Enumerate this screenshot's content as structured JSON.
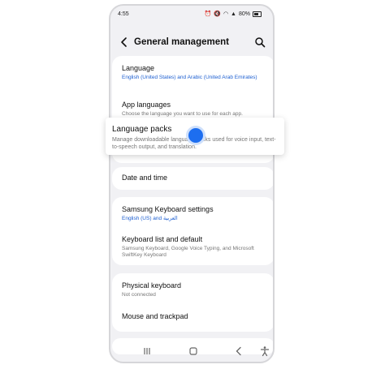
{
  "status": {
    "time": "4:55",
    "battery": "80%"
  },
  "header": {
    "title": "General management"
  },
  "items": {
    "language": {
      "title": "Language",
      "sub": "English (United States) and Arabic (United Arab Emirates)"
    },
    "app_languages": {
      "title": "App languages",
      "sub": "Choose the language you want to use for each app."
    },
    "language_packs": {
      "title": "Language packs",
      "sub": "Manage downloadable language packs used for voice input, text-to-speech output, and translation."
    },
    "date_time": {
      "title": "Date and time"
    },
    "samsung_keyboard": {
      "title": "Samsung Keyboard settings",
      "sub": "English (US) and العربية"
    },
    "keyboard_list": {
      "title": "Keyboard list and default",
      "sub": "Samsung Keyboard, Google Voice Typing, and Microsoft SwiftKey Keyboard"
    },
    "physical_keyboard": {
      "title": "Physical keyboard",
      "sub": "Not connected"
    },
    "mouse_trackpad": {
      "title": "Mouse and trackpad"
    }
  },
  "colors": {
    "accent": "#1d6ef0",
    "link": "#1d5fd1",
    "background": "#f1f1f4"
  }
}
